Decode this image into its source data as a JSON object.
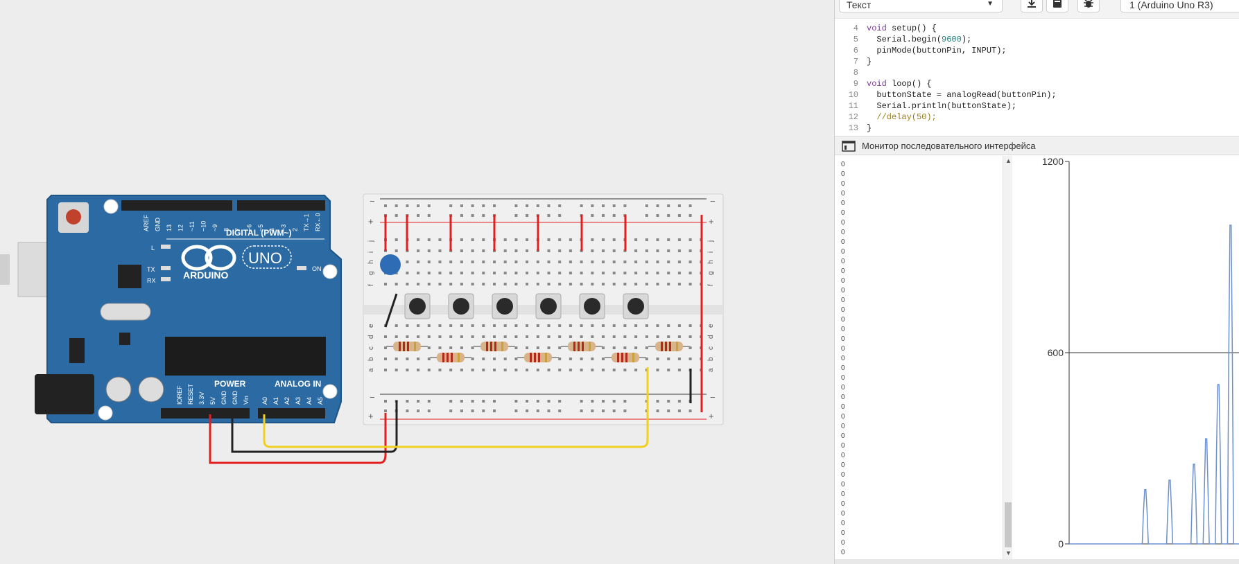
{
  "toolbar": {
    "mode_label": "Текст",
    "download_icon": "download-icon",
    "library_icon": "library-icon",
    "debug_icon": "debug-bug-icon",
    "board_label": "1 (Arduino Uno R3)"
  },
  "code": {
    "line_numbers": [
      "4",
      "5",
      "6",
      "7",
      "8",
      "9",
      "10",
      "11",
      "12",
      "13"
    ]
  },
  "serial": {
    "title": "Монитор последовательного интерфейса",
    "values": [
      "0",
      "0",
      "0",
      "0",
      "0",
      "0",
      "0",
      "0",
      "0",
      "0",
      "0",
      "0",
      "0",
      "0",
      "0",
      "0",
      "0",
      "0",
      "0",
      "0",
      "0",
      "0",
      "0",
      "0",
      "0",
      "0",
      "0",
      "0",
      "0",
      "0",
      "0",
      "0",
      "0",
      "0",
      "0",
      "0",
      "0",
      "0",
      "0",
      "0",
      "0"
    ]
  },
  "circuit": {
    "board_brand": "ARDUINO",
    "board_model": "UNO",
    "header_digital": "DIGITAL (PWM~)",
    "header_power": "POWER",
    "header_analog": "ANALOG IN",
    "on_label": "ON",
    "digital_pins": [
      "AREF",
      "GND",
      "13",
      "12",
      "~11",
      "~10",
      "~9",
      "8",
      "7",
      "~6",
      "~5",
      "4",
      "~3",
      "2",
      "TX→1",
      "RX←0"
    ],
    "power_pins": [
      "IOREF",
      "RESET",
      "3.3V",
      "5V",
      "GND",
      "GND",
      "Vin"
    ],
    "analog_pins": [
      "A0",
      "A1",
      "A2",
      "A3",
      "A4",
      "A5"
    ],
    "led_labels": [
      "L",
      "TX",
      "RX"
    ],
    "breadboard_rows": [
      "a",
      "b",
      "c",
      "d",
      "e",
      "f",
      "g",
      "h",
      "i",
      "j"
    ],
    "rail_plus": "+",
    "rail_minus": "−",
    "colors": {
      "wire_red": "#e02020",
      "wire_black": "#222222",
      "wire_yellow": "#f0d020",
      "board_blue": "#2b6aa3",
      "resistor": "#d9b48a"
    }
  },
  "chart_data": {
    "type": "line",
    "x": [
      0,
      10,
      20,
      30,
      40,
      50,
      60,
      61,
      62,
      63,
      64,
      65,
      66,
      70,
      80,
      81,
      82,
      83,
      84,
      85,
      86,
      90,
      100,
      101,
      102,
      103,
      104,
      105,
      106,
      110,
      111,
      112,
      113,
      114,
      115,
      116,
      120,
      121,
      122,
      123,
      124,
      125,
      126,
      130,
      131,
      132,
      133,
      134,
      135,
      136,
      140
    ],
    "series": [
      {
        "values": [
          0,
          0,
          0,
          0,
          0,
          0,
          0,
          100,
          170,
          170,
          100,
          0,
          0,
          0,
          0,
          110,
          200,
          200,
          110,
          0,
          0,
          0,
          0,
          150,
          250,
          250,
          150,
          0,
          0,
          0,
          170,
          330,
          330,
          170,
          0,
          0,
          0,
          300,
          500,
          500,
          300,
          0,
          0,
          0,
          580,
          1000,
          1000,
          580,
          0,
          0,
          0
        ]
      }
    ],
    "ylim": [
      0,
      1200
    ],
    "y_ticks": [
      "1200",
      "600",
      "0"
    ],
    "grid": "horizontal at 600"
  }
}
